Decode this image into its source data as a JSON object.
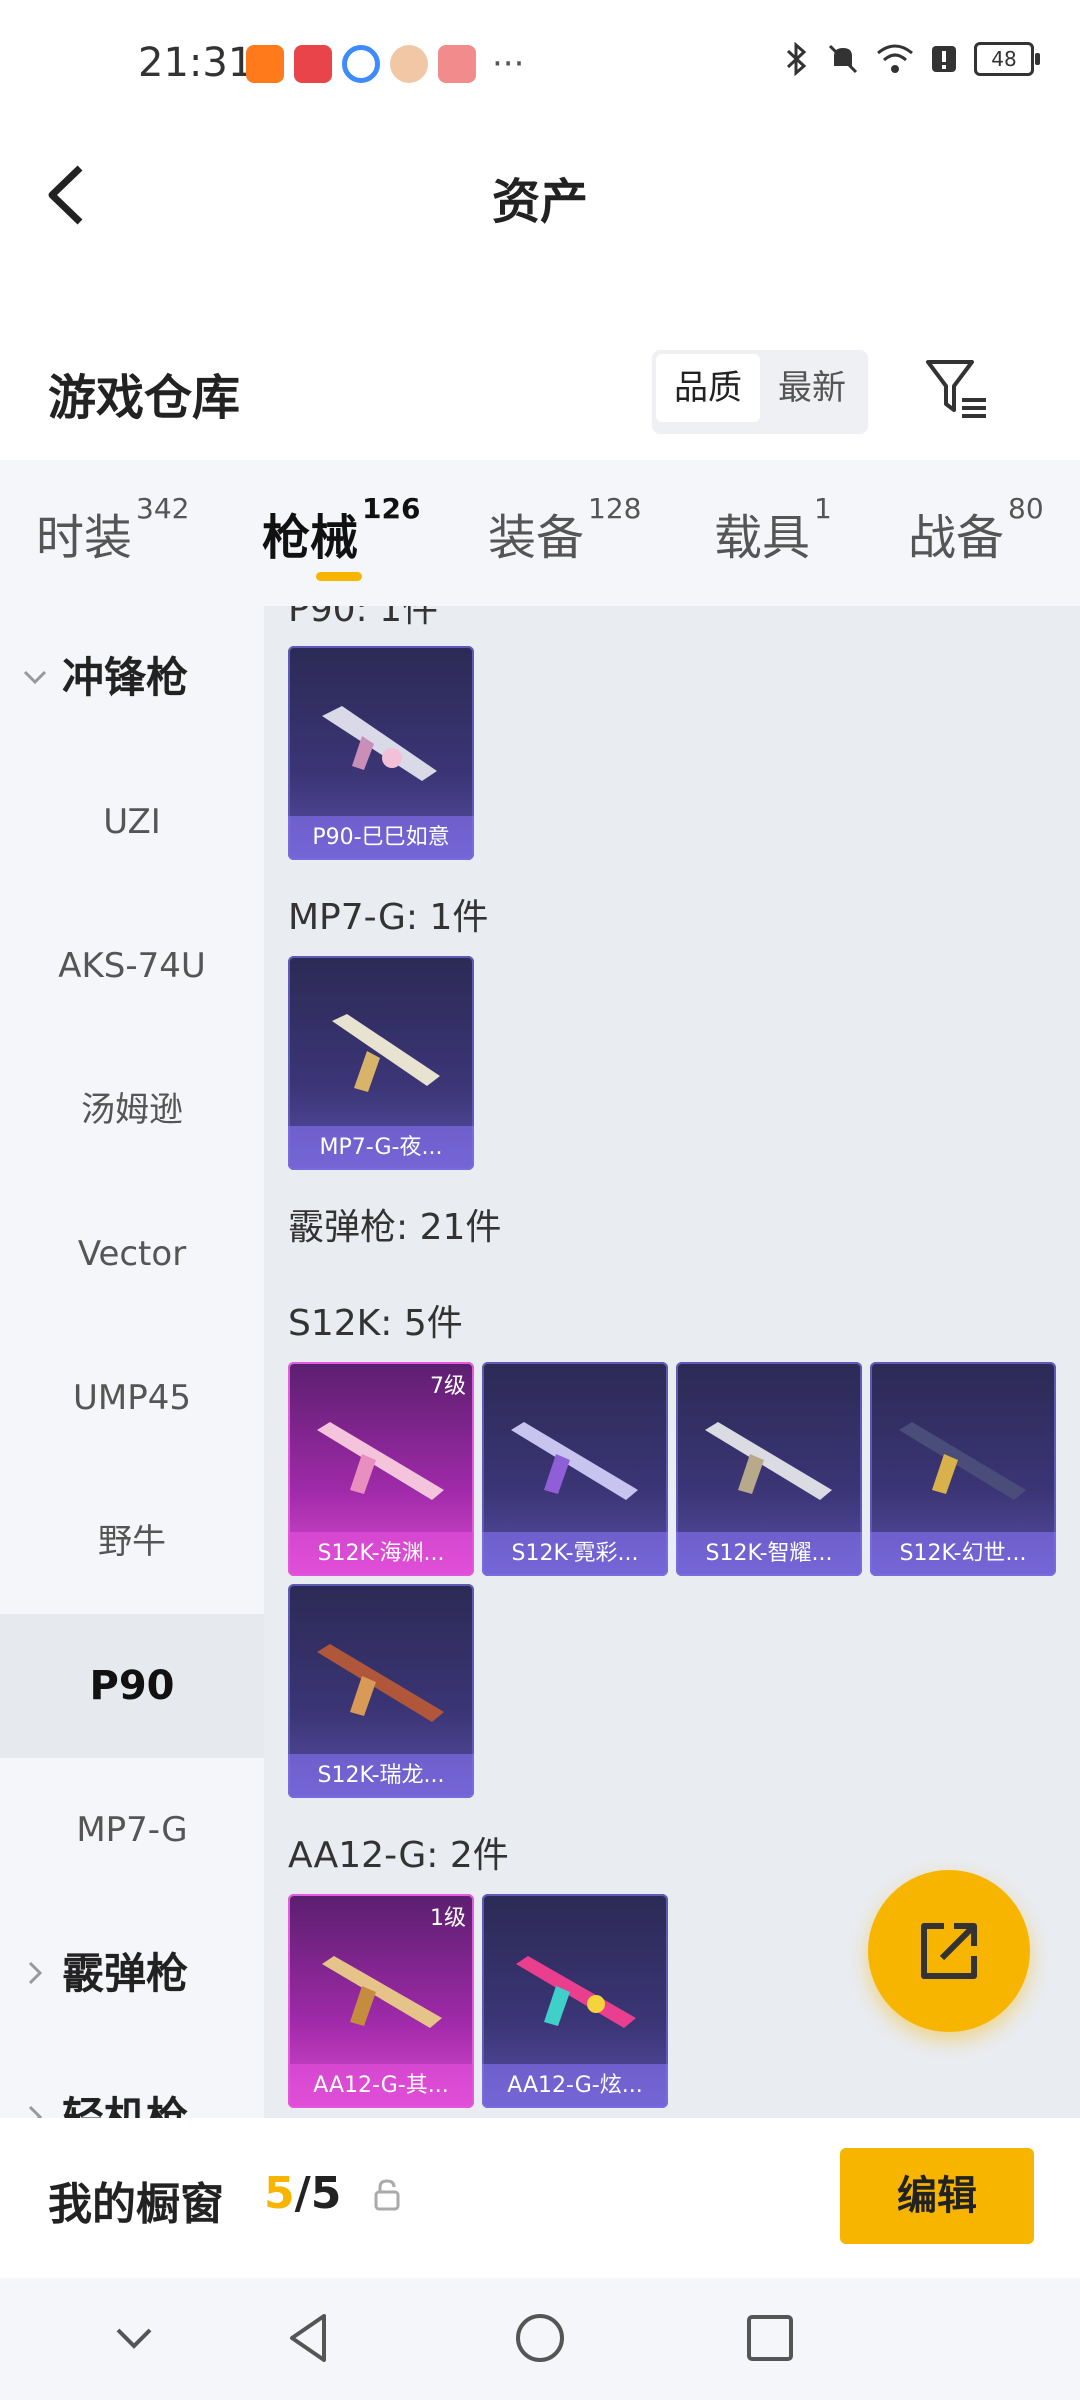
{
  "status_bar": {
    "time": "21:31",
    "more": "···",
    "battery": "48"
  },
  "header": {
    "title": "资产"
  },
  "repo": {
    "title": "游戏仓库",
    "sort_options": [
      "品质",
      "最新"
    ]
  },
  "tabs": [
    {
      "label": "时装",
      "count": "342"
    },
    {
      "label": "枪械",
      "count": "126"
    },
    {
      "label": "装备",
      "count": "128"
    },
    {
      "label": "载具",
      "count": "1"
    },
    {
      "label": "战备",
      "count": "80"
    }
  ],
  "sidebar": {
    "items": [
      {
        "label": "冲锋枪"
      },
      {
        "label": "UZI"
      },
      {
        "label": "AKS-74U"
      },
      {
        "label": "汤姆逊"
      },
      {
        "label": "Vector"
      },
      {
        "label": "UMP45"
      },
      {
        "label": "野牛"
      },
      {
        "label": "P90"
      },
      {
        "label": "MP7-G"
      },
      {
        "label": "霰弹枪"
      },
      {
        "label": "轻机枪"
      }
    ]
  },
  "content": {
    "partial_heading": "P90: 1件",
    "groups": [
      {
        "label": "MP7-G: 1件"
      },
      {
        "label": "霰弹枪: 21件"
      },
      {
        "label": "S12K: 5件"
      },
      {
        "label": "AA12-G: 2件"
      }
    ],
    "cards": [
      {
        "caption": "P90-巳巳如意",
        "level": ""
      },
      {
        "caption": "MP7-G-夜...",
        "level": ""
      },
      {
        "caption": "S12K-海渊...",
        "level": "7级"
      },
      {
        "caption": "S12K-霓彩...",
        "level": ""
      },
      {
        "caption": "S12K-智耀...",
        "level": ""
      },
      {
        "caption": "S12K-幻世...",
        "level": ""
      },
      {
        "caption": "S12K-瑞龙...",
        "level": ""
      },
      {
        "caption": "AA12-G-其...",
        "level": "1级"
      },
      {
        "caption": "AA12-G-炫...",
        "level": ""
      }
    ]
  },
  "showcase": {
    "label": "我的橱窗",
    "current": "5",
    "total": "/5",
    "edit_label": "编辑"
  },
  "colors": {
    "accent": "#f7b500",
    "card_purple": "#3b3576",
    "card_pink": "#a02aa9"
  }
}
